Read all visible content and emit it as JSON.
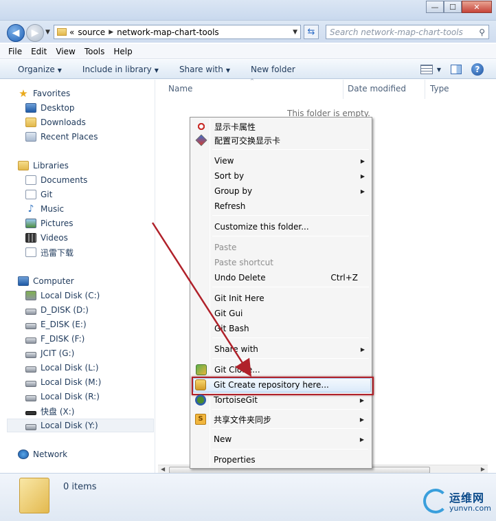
{
  "window": {
    "controls": {
      "minimize": "—",
      "maximize": "☐",
      "close": "✕"
    }
  },
  "address": {
    "prefix": "«",
    "path": [
      "source",
      "network-map-chart-tools"
    ],
    "search_placeholder": "Search network-map-chart-tools"
  },
  "menubar": [
    "File",
    "Edit",
    "View",
    "Tools",
    "Help"
  ],
  "toolbar": {
    "organize": "Organize",
    "include_in_library": "Include in library",
    "share_with": "Share with",
    "new_folder": "New folder",
    "help": "?"
  },
  "navpane": {
    "favorites": {
      "label": "Favorites",
      "items": [
        "Desktop",
        "Downloads",
        "Recent Places"
      ]
    },
    "libraries": {
      "label": "Libraries",
      "items": [
        "Documents",
        "Git",
        "Music",
        "Pictures",
        "Videos",
        "迅雷下载"
      ]
    },
    "computer": {
      "label": "Computer",
      "items": [
        "Local Disk (C:)",
        "D_DISK (D:)",
        "E_DISK (E:)",
        "F_DISK (F:)",
        "JCIT (G:)",
        "Local Disk (L:)",
        "Local Disk (M:)",
        "Local Disk (R:)",
        "快盘 (X:)",
        "Local Disk (Y:)"
      ],
      "selected": "Local Disk (Y:)"
    },
    "network": {
      "label": "Network"
    }
  },
  "columns": {
    "name": "Name",
    "date_modified": "Date modified",
    "type": "Type"
  },
  "empty_message": "This folder is empty.",
  "status": {
    "items": "0 items"
  },
  "watermark": {
    "cn": "运维网",
    "en": "yunvn.com"
  },
  "context_menu": {
    "items": [
      {
        "label": "显示卡属性",
        "icon": "gear-icon"
      },
      {
        "label": "配置可交换显示卡",
        "icon": "diamond-icon"
      },
      {
        "label": "View",
        "submenu": true
      },
      {
        "label": "Sort by",
        "submenu": true
      },
      {
        "label": "Group by",
        "submenu": true
      },
      {
        "label": "Refresh"
      },
      {
        "label": "Customize this folder..."
      },
      {
        "label": "Paste",
        "disabled": true
      },
      {
        "label": "Paste shortcut",
        "disabled": true
      },
      {
        "label": "Undo Delete",
        "shortcut": "Ctrl+Z"
      },
      {
        "label": "Git Init Here"
      },
      {
        "label": "Git Gui"
      },
      {
        "label": "Git Bash"
      },
      {
        "label": "Share with",
        "submenu": true
      },
      {
        "label": "Git Clone...",
        "icon": "git-clone-icon"
      },
      {
        "label": "Git Create repository here...",
        "icon": "git-create-icon",
        "highlighted": true
      },
      {
        "label": "TortoiseGit",
        "icon": "tortoisegit-icon",
        "submenu": true
      },
      {
        "label": "共享文件夹同步",
        "icon": "sync-icon",
        "submenu": true
      },
      {
        "label": "New",
        "submenu": true
      },
      {
        "label": "Properties"
      }
    ]
  },
  "colors": {
    "highlight_box": "#b0212a",
    "arrow": "#b0212a",
    "accent": "#1e395b"
  }
}
